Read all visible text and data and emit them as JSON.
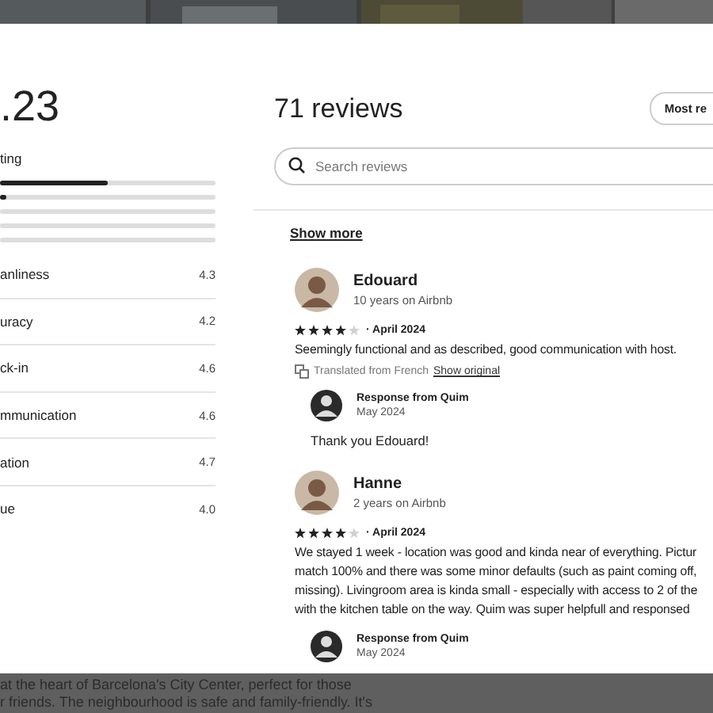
{
  "overall": {
    "rating": ".23",
    "label": "ting"
  },
  "rating_bars": [
    {
      "level": 0.5
    },
    {
      "level": 0.03
    },
    {
      "level": 0
    },
    {
      "level": 0
    },
    {
      "level": 0
    }
  ],
  "categories": [
    {
      "name": "anliness",
      "value": "4.3"
    },
    {
      "name": "uracy",
      "value": "4.2"
    },
    {
      "name": "ck-in",
      "value": "4.6"
    },
    {
      "name": "mmunication",
      "value": "4.6"
    },
    {
      "name": "ation",
      "value": "4.7"
    },
    {
      "name": "ue",
      "value": "4.0"
    }
  ],
  "reviews_header": {
    "title": "71 reviews",
    "sort_button": "Most re"
  },
  "search": {
    "placeholder": "Search reviews"
  },
  "show_more": "Show more",
  "reviews": [
    {
      "name": "Edouard",
      "tenure": "10 years on Airbnb",
      "stars": 4,
      "date": "· April 2024",
      "text_lines": [
        "Seemingly functional and as described, good communication with host."
      ],
      "translated": "Translated from French",
      "show_original": "Show original",
      "response": {
        "title": "Response from Quim",
        "date": "May 2024",
        "text": "Thank you Edouard!"
      }
    },
    {
      "name": "Hanne",
      "tenure": "2 years on Airbnb",
      "stars": 4,
      "date": "· April 2024",
      "text_lines": [
        "We stayed 1 week - location was good and kinda near of everything. Pictur",
        "match 100% and there was some minor defaults (such as paint coming off,",
        "missing). Livingroom area is kinda small - especially with access to 2 of the",
        "with the kitchen table on the way. Quim was super helpfull and responsed"
      ],
      "response": {
        "title": "Response from Quim",
        "date": "May 2024"
      }
    }
  ],
  "background_text": [
    "at the heart of Barcelona's City Center, perfect for those",
    "r friends. The neighbourhood is safe and family-friendly. It's"
  ]
}
